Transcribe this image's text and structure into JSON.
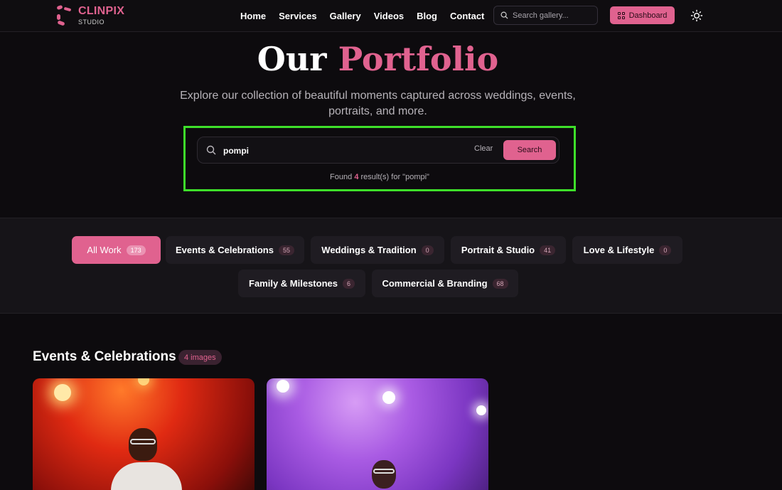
{
  "brand": {
    "name": "CLINPIX",
    "sub": "STUDIO",
    "accent": "#e0628f"
  },
  "nav": {
    "links": [
      "Home",
      "Services",
      "Gallery",
      "Videos",
      "Blog",
      "Contact"
    ],
    "search_placeholder": "Search gallery...",
    "dashboard_label": "Dashboard"
  },
  "hero": {
    "title_plain": "Our",
    "title_accent": "Portfolio",
    "subtitle": "Explore our collection of beautiful moments captured across weddings, events, portraits, and more."
  },
  "search": {
    "value": "pompi",
    "clear_label": "Clear",
    "button_label": "Search",
    "result_prefix": "Found",
    "result_count": "4",
    "result_suffix": "result(s) for \"pompi\""
  },
  "filters": [
    {
      "label": "All Work",
      "count": "173",
      "active": true
    },
    {
      "label": "Events & Celebrations",
      "count": "55",
      "active": false
    },
    {
      "label": "Weddings & Tradition",
      "count": "0",
      "active": false
    },
    {
      "label": "Portrait & Studio",
      "count": "41",
      "active": false
    },
    {
      "label": "Love & Lifestyle",
      "count": "0",
      "active": false
    },
    {
      "label": "Family & Milestones",
      "count": "6",
      "active": false
    },
    {
      "label": "Commercial & Branding",
      "count": "68",
      "active": false
    }
  ],
  "section": {
    "title": "Events & Celebrations",
    "badge": "4 images"
  },
  "cards": [
    {
      "name": "event-photo-red-stage"
    },
    {
      "name": "event-photo-purple-stage"
    }
  ],
  "icons": [
    "search-icon",
    "grid-icon",
    "sun-icon"
  ]
}
